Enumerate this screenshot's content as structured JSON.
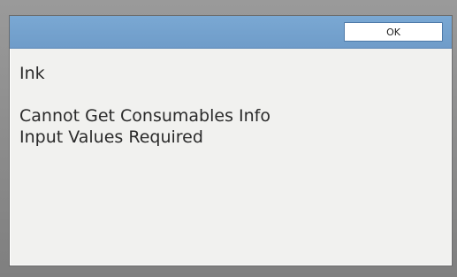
{
  "dialog": {
    "ok_label": "OK",
    "title": "Ink",
    "messages": [
      "Cannot Get Consumables Info",
      "Input Values Required"
    ]
  }
}
